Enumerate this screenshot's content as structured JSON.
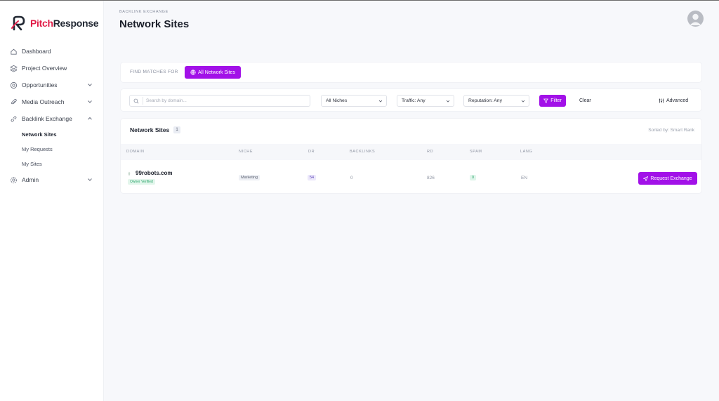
{
  "brand": {
    "name_part1": "Pitch",
    "name_part2": "Response"
  },
  "sidebar": {
    "items": [
      {
        "label": "Dashboard",
        "icon": "home-icon"
      },
      {
        "label": "Project Overview",
        "icon": "layers-icon"
      },
      {
        "label": "Opportunities",
        "icon": "target-icon"
      },
      {
        "label": "Media Outreach",
        "icon": "paperclip-icon"
      },
      {
        "label": "Backlink Exchange",
        "icon": "link-icon"
      },
      {
        "label": "Admin",
        "icon": "gear-icon"
      }
    ],
    "sub_items": [
      "Network Sites",
      "My Requests",
      "My Sites"
    ]
  },
  "header": {
    "eyebrow": "BACKLINK EXCHANGE",
    "title": "Network Sites"
  },
  "find": {
    "label": "FIND MATCHES FOR",
    "button": "All Network Sites"
  },
  "filters": {
    "search_placeholder": "Search by domain...",
    "niche": "All Niches",
    "traffic": "Traffic: Any",
    "reputation": "Reputation: Any",
    "filter_button": "Filter",
    "clear_button": "Clear",
    "advanced_button": "Advanced"
  },
  "table": {
    "title": "Network Sites",
    "count": "1",
    "sorted_by": "Sorted by: Smart Rank",
    "columns": [
      "DOMAIN",
      "NICHE",
      "DR",
      "BACKLINKS",
      "RD",
      "SPAM",
      "LANG"
    ],
    "rows": [
      {
        "domain": "99robots.com",
        "verified": "Owner Verified",
        "niche": "Marketing",
        "dr": "54",
        "backlinks": "0",
        "rd": "826",
        "spam": "0",
        "lang": "EN",
        "action": "Request Exchange"
      }
    ]
  },
  "colors": {
    "accent": "#a211e8",
    "brand_red": "#e11d48",
    "verified_green": "#2aa56a"
  }
}
